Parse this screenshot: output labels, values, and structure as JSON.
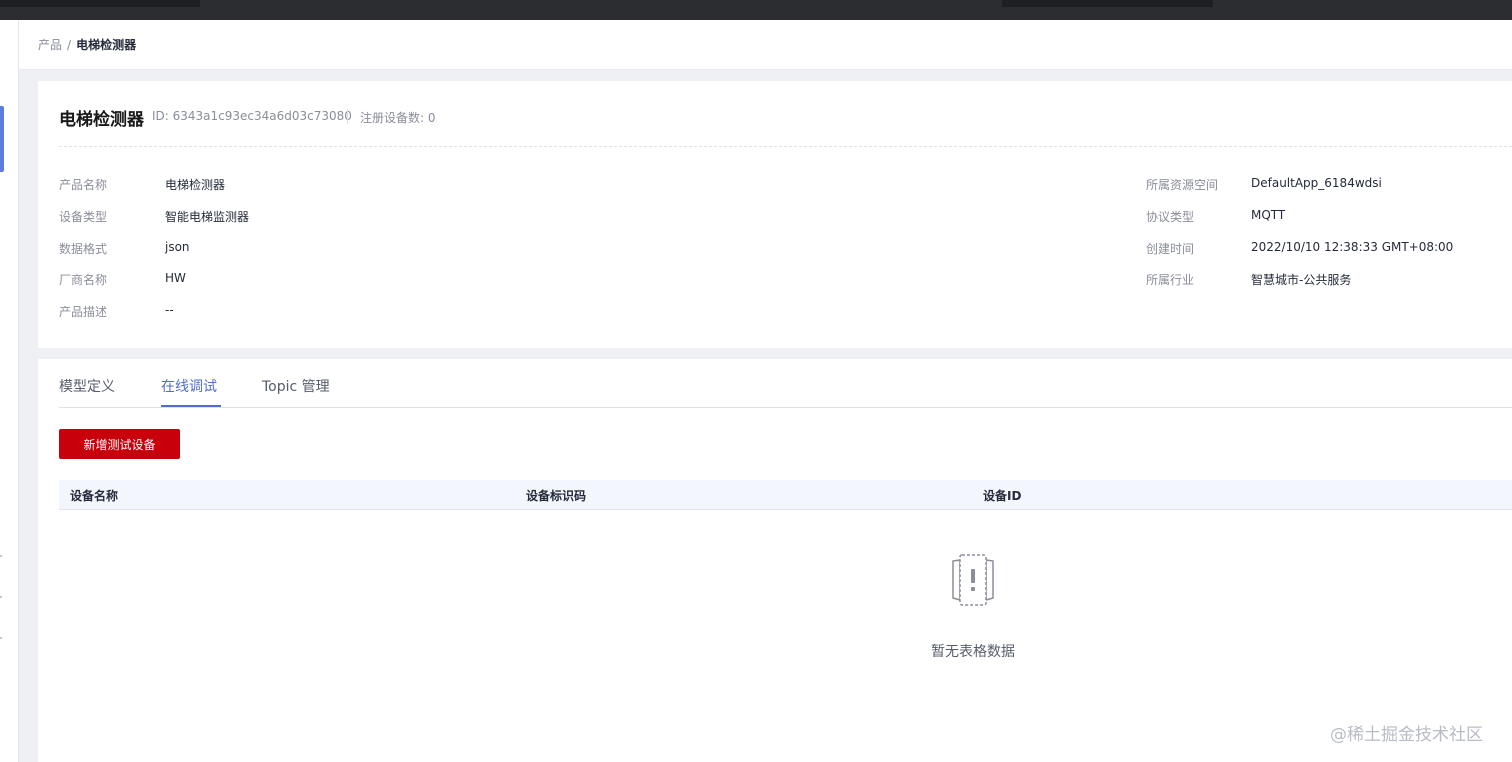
{
  "breadcrumb": {
    "root": "产品",
    "separator": "/",
    "current": "电梯检测器"
  },
  "product": {
    "title": "电梯检测器",
    "id_text": "ID: 6343a1c93ec34a6d03c73080",
    "device_count_text": "注册设备数: 0"
  },
  "info": {
    "left": [
      {
        "label": "产品名称",
        "value": "电梯检测器"
      },
      {
        "label": "设备类型",
        "value": "智能电梯监测器"
      },
      {
        "label": "数据格式",
        "value": "json"
      },
      {
        "label": "厂商名称",
        "value": "HW"
      },
      {
        "label": "产品描述",
        "value": "--"
      }
    ],
    "right": [
      {
        "label": "所属资源空间",
        "value": "DefaultApp_6184wdsi"
      },
      {
        "label": "协议类型",
        "value": "MQTT"
      },
      {
        "label": "创建时间",
        "value": "2022/10/10 12:38:33 GMT+08:00"
      },
      {
        "label": "所属行业",
        "value": "智慧城市-公共服务"
      }
    ]
  },
  "tabs": [
    {
      "label": "模型定义",
      "active": false
    },
    {
      "label": "在线调试",
      "active": true
    },
    {
      "label": "Topic 管理",
      "active": false
    }
  ],
  "actions": {
    "add_test_device": "新增测试设备"
  },
  "table": {
    "columns": [
      "设备名称",
      "设备标识码",
      "设备ID"
    ],
    "rows": [],
    "empty_text": "暂无表格数据",
    "empty_icon": "empty-document-icon"
  },
  "watermark": "@稀土掘金技术社区",
  "colors": {
    "primary_button": "#c7000b",
    "active_tab": "#526ecc",
    "page_bg": "#eef0f4"
  }
}
